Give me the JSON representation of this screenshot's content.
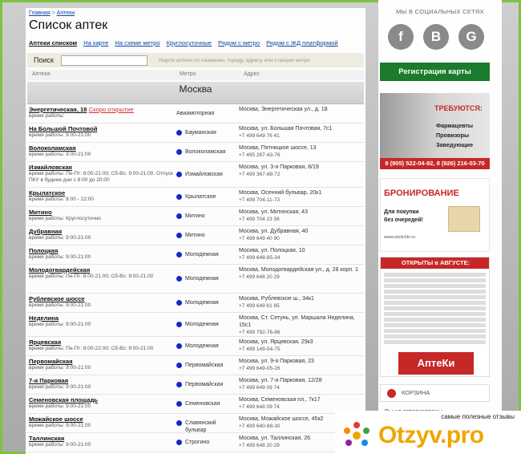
{
  "breadcrumb": {
    "home": "Главная",
    "sep": ">",
    "current": "Аптеки"
  },
  "title": "Список аптек",
  "tabs": [
    "Аптеки списком",
    "На карте",
    "На схеме метро",
    "Круглосуточные",
    "Рядом с метро",
    "Рядом с ЖД платформой"
  ],
  "search": {
    "label": "Поиск",
    "value": "",
    "hint": "Ищите аптеки по названию, городу, адресу или станции метро"
  },
  "columns": {
    "pharmacy": "Аптека",
    "metro": "Метро",
    "address": "Адрес"
  },
  "city": "Москва",
  "pharmacies": [
    {
      "name": "Энергетическая, 18",
      "soon": "Скоро открытие",
      "hours": "время работы:",
      "metro": "Авиамоторная",
      "dot": false,
      "address": "Москва, Энергетическая ул., д. 18",
      "phone": ""
    },
    {
      "name": "На Большой Почтовой",
      "hours": "время работы: 9:00-21:00",
      "metro": "Бауманская",
      "dot": true,
      "address": "Москва, ул. Большая Почтовая, 7с1",
      "phone": "+7 499 649 76 41"
    },
    {
      "name": "Волоколамская",
      "hours": "время работы: 9:00-21:00",
      "metro": "Волоколамская",
      "dot": true,
      "address": "Москва, Пятницкое шоссе, 13",
      "phone": "+7 495 287-43-76"
    },
    {
      "name": "Измайловская",
      "hours": "время работы: Пн-Пт: 8:00-21:00; Сб-Вс: 9:00-21:00. Отпуск ПКУ в будние дни с 8:00 до 20:00",
      "metro": "Измайловская",
      "dot": true,
      "address": "Москва, ул. 3-я Парковая, 8/19",
      "phone": "+7 499 367-88-72"
    },
    {
      "name": "Крылатское",
      "hours": "время работы: 8:00 - 22:00",
      "metro": "Крылатское",
      "dot": true,
      "address": "Москва, Осенний бульвар, 20к1",
      "phone": "+7 499 704-11-73"
    },
    {
      "name": "Митино",
      "hours": "время работы: Круглосуточно",
      "metro": "Митино",
      "dot": true,
      "address": "Москва, ул. Митинская, 43",
      "phone": "+7 499 704 23 56"
    },
    {
      "name": "Дубравная",
      "hours": "время работы: 9:00-21:00",
      "metro": "Митино",
      "dot": true,
      "address": "Москва, ул. Дубравная, 40",
      "phone": "+7 499 649 40 90"
    },
    {
      "name": "Полоцкая",
      "hours": "время работы: 9:00-21:00",
      "metro": "Молодежная",
      "dot": true,
      "address": "Москва, ул. Полоцкая, 10",
      "phone": "+7 499 648-85-34"
    },
    {
      "name": "Молодогвардейская",
      "hours": "время работы: Пн-Пт: 8.00-21.00; Сб-Вс: 9:00-21.00",
      "metro": "Молодежная",
      "dot": true,
      "address": "Москва, Молодогвардейская ул., д. 28 корп. 1",
      "phone": "+7 499 648 20 29"
    },
    {
      "name": "Рублевское шоссе",
      "hours": "время работы: 9:00-21:00",
      "metro": "Молодежная",
      "dot": true,
      "address": "Москва, Рублевское ш., 34к1",
      "phone": "+7 499 649 61 85"
    },
    {
      "name": "Неделина",
      "hours": "время работы: 9:00-21:00",
      "metro": "Молодежная",
      "dot": true,
      "address": "Москва, Ст. Сетунь, ул. Маршала Неделина, 15с1",
      "phone": "+7 499 792-76-86"
    },
    {
      "name": "Ярцевская",
      "hours": "время работы: Пн-Пт: 8:00-22:00; Сб-Вс: 9:00-21:00",
      "metro": "Молодежная",
      "dot": true,
      "address": "Москва, ул. Ярцевская, 29к3",
      "phone": "+7 499 149-54-75"
    },
    {
      "name": "Первомайская",
      "hours": "время работы: 9:00-21:00",
      "metro": "Первомайская",
      "dot": true,
      "address": "Москва, ул. 9-я Парковая, 23",
      "phone": "+7 499 649-05-26"
    },
    {
      "name": "7-я Парковая",
      "hours": "время работы: 9:00-21:00",
      "metro": "Первомайская",
      "dot": true,
      "address": "Москва, ул. 7-я Парковая, 12/28",
      "phone": "+7 499 649 09 74"
    },
    {
      "name": "Семеновская площадь",
      "hours": "время работы: 9:00-21:00",
      "metro": "Семеновская",
      "dot": true,
      "address": "Москва, Семеновская пл., 7к17",
      "phone": "+7 499 648 09 74"
    },
    {
      "name": "Можайское шоссе",
      "hours": "время работы: 9:00-21:00",
      "metro": "Славянский бульвар",
      "dot": true,
      "address": "Москва, Можайское шоссе, 45к2",
      "phone": "+7 499 640-88-30"
    },
    {
      "name": "Таллинская",
      "hours": "время работы: 9:00-21:00",
      "metro": "Строгино",
      "dot": true,
      "address": "Москва, ул. Таллинская, 26",
      "phone": "+7 499 648 20 29"
    }
  ],
  "sidebar": {
    "social_title": "МЫ В СОЦИАЛЬНЫХ СЕТЯХ",
    "social": [
      "f",
      "B",
      "G"
    ],
    "register": "Регистрация карты",
    "ad1": {
      "head": "ТРЕБУЮТСЯ:",
      "items": [
        "Фармацевты",
        "Провизоры",
        "Заведующие"
      ],
      "phones": "8 (905) 522-04-92, 8 (926) 216-03-70"
    },
    "ad2": {
      "title": "БРОНИРОВАНИЕ",
      "sub1": "Для покупки",
      "sub2": "без очередей!",
      "url": "www.stolichki.ru"
    },
    "ad3": {
      "head": "ОТКРЫТЫ в АВГУСТЕ:",
      "logo": "АптеКи"
    },
    "cart": "КОРЗИНА",
    "cart_note": "Вы не авторизованы"
  },
  "watermark": {
    "caption": "самые полезные отзывы",
    "logo": "Otzyv.pro"
  },
  "colors": {
    "frame": "#7fc241",
    "register": "#1a7c2c",
    "metro_dot": "#1627c9",
    "brand_red": "#c62828"
  }
}
